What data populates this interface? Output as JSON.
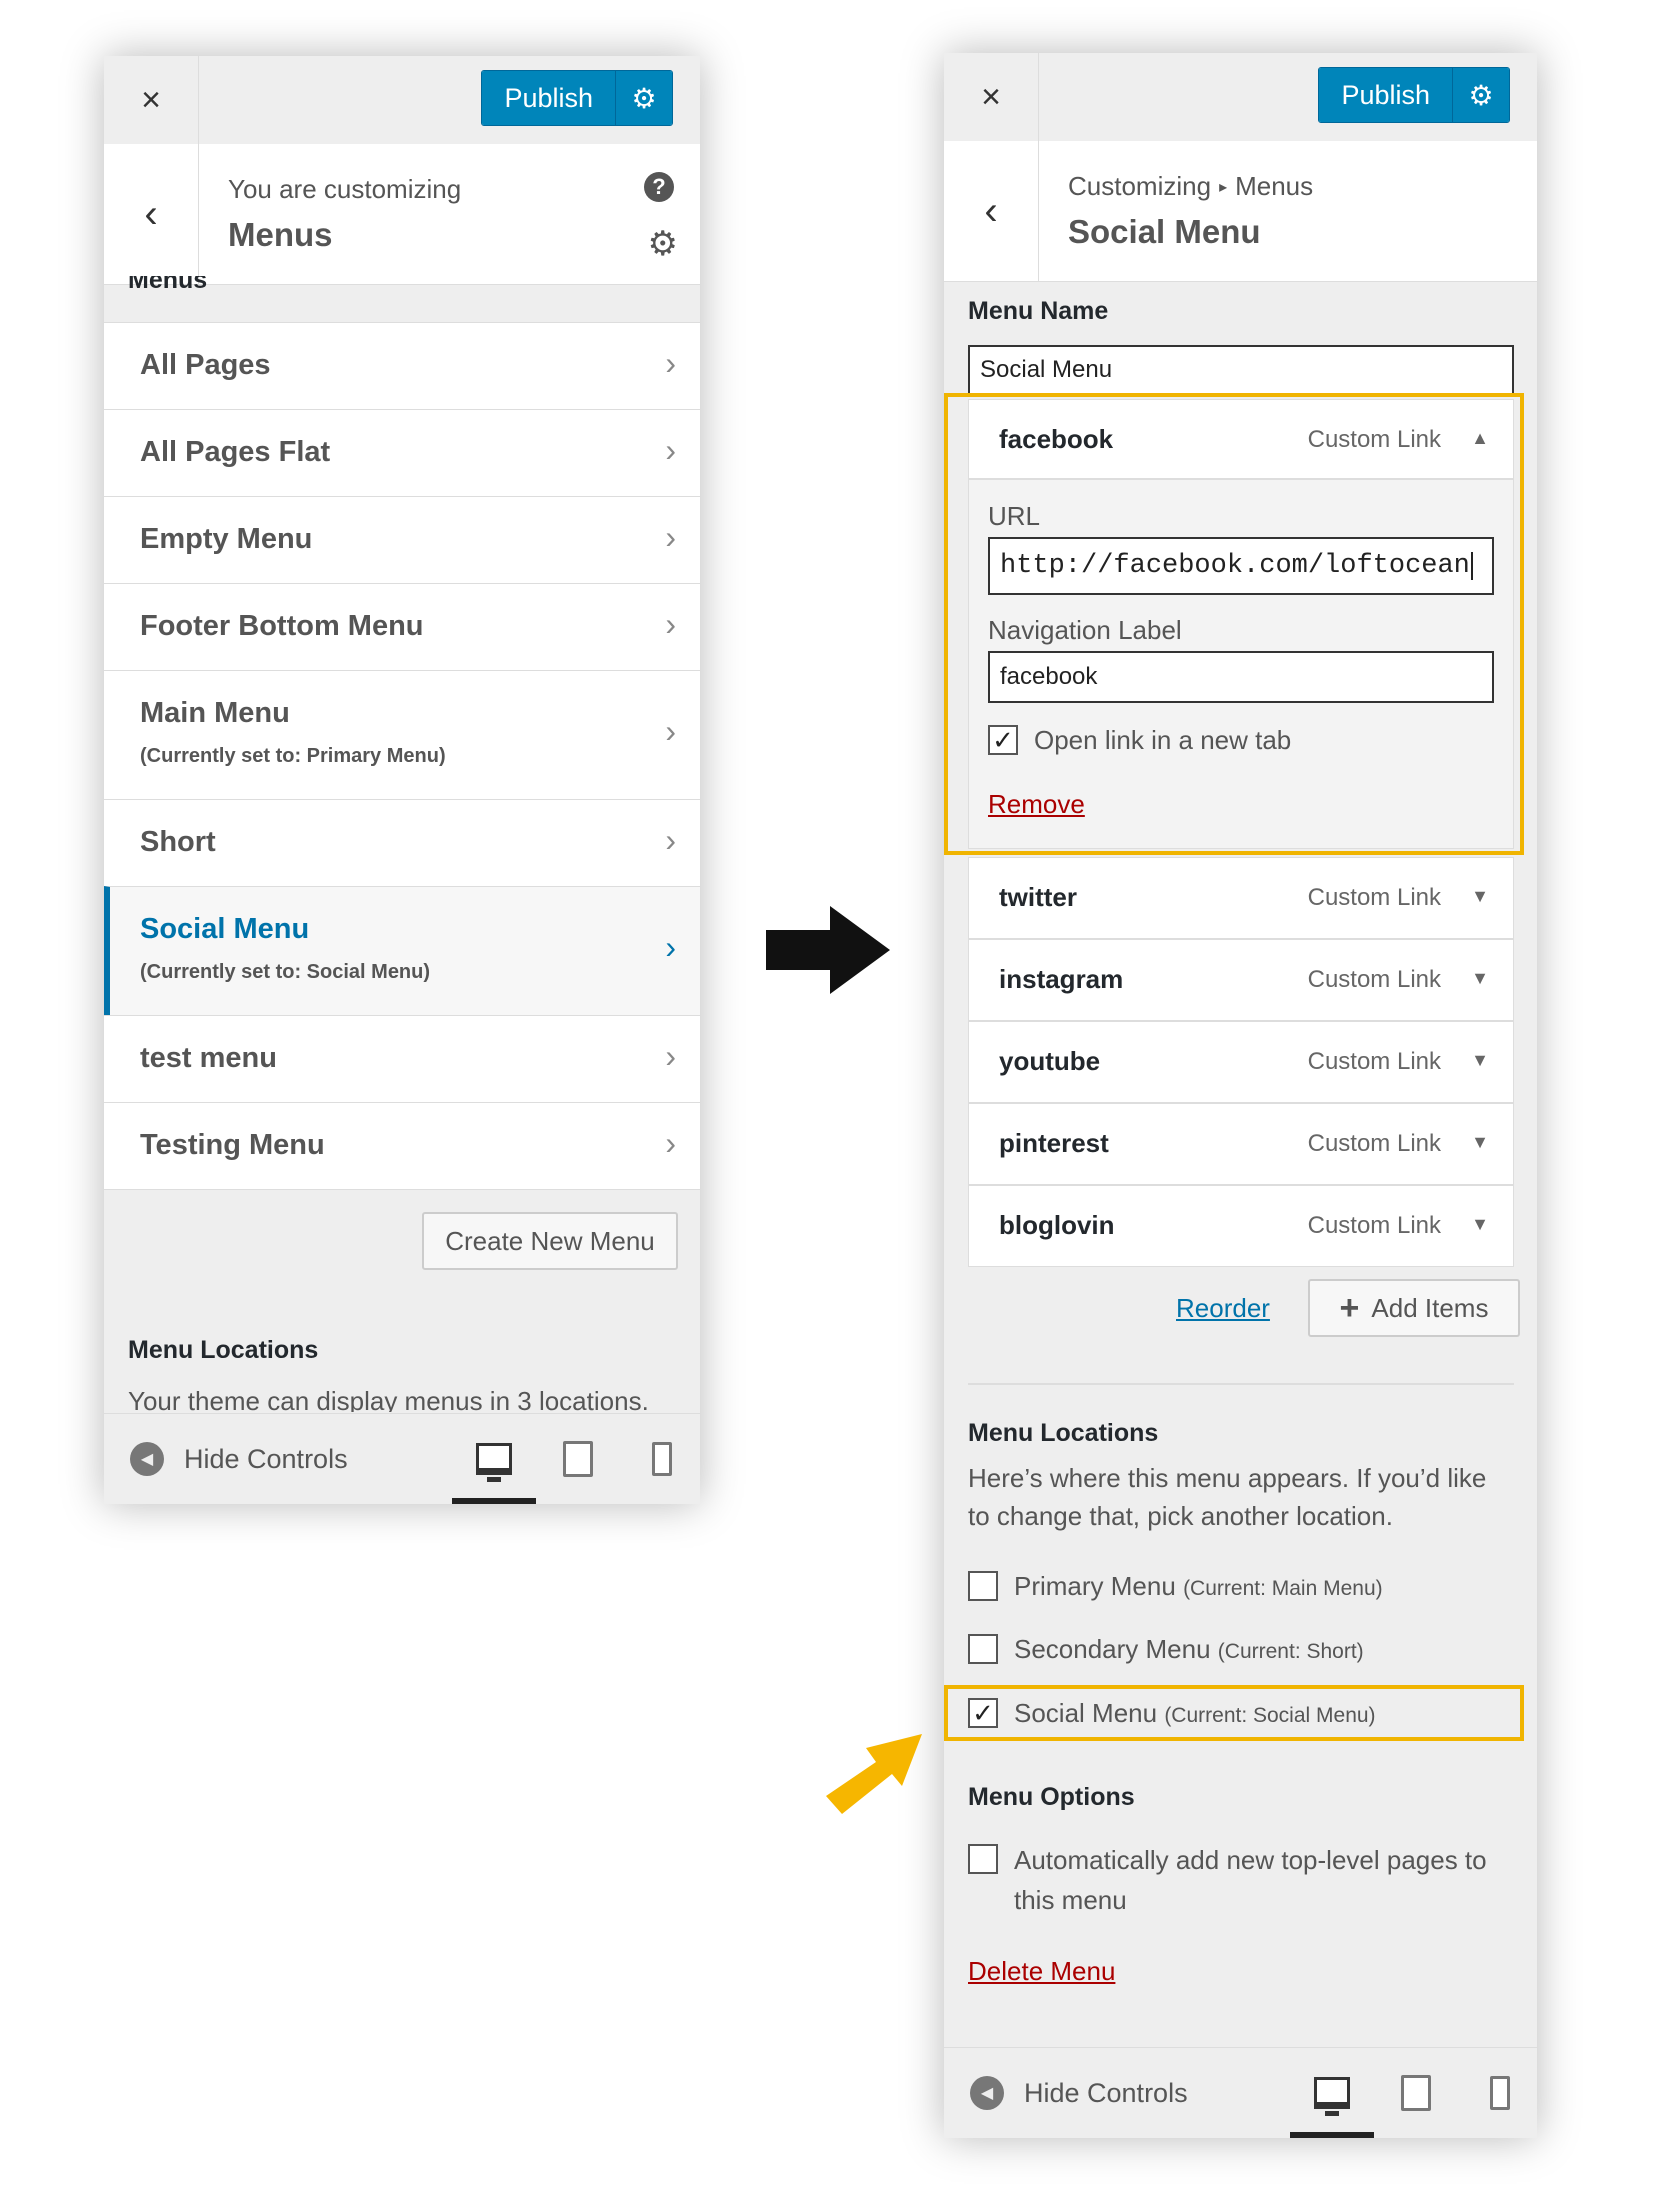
{
  "left_panel": {
    "close_icon": "×",
    "publish_label": "Publish",
    "subtitle": "You are customizing",
    "title": "Menus",
    "help_icon": "?",
    "clipped_heading": "Menus",
    "menus": [
      {
        "label": "All Pages",
        "sub": ""
      },
      {
        "label": "All Pages Flat",
        "sub": ""
      },
      {
        "label": "Empty Menu",
        "sub": ""
      },
      {
        "label": "Footer Bottom Menu",
        "sub": ""
      },
      {
        "label": "Main Menu",
        "sub": "(Currently set to: Primary Menu)"
      },
      {
        "label": "Short",
        "sub": ""
      },
      {
        "label": "Social Menu",
        "sub": "(Currently set to: Social Menu)"
      },
      {
        "label": "test menu",
        "sub": ""
      },
      {
        "label": "Testing Menu",
        "sub": ""
      }
    ],
    "create_button": "Create New Menu",
    "locations_heading": "Menu Locations",
    "locations_desc": "Your theme can display menus in 3 locations.",
    "hide_controls": "Hide Controls"
  },
  "right_panel": {
    "close_icon": "×",
    "publish_label": "Publish",
    "breadcrumb_root": "Customizing",
    "breadcrumb_sep": "▸",
    "breadcrumb_leaf": "Menus",
    "title": "Social Menu",
    "menu_name_label": "Menu Name",
    "menu_name_value": "Social Menu",
    "expanded_item": {
      "title": "facebook",
      "type": "Custom Link",
      "url_label": "URL",
      "url_value": "http://facebook.com/loftocean",
      "nav_label_label": "Navigation Label",
      "nav_label_value": "facebook",
      "new_tab_label": "Open link in a new tab",
      "new_tab_checked": true,
      "remove_label": "Remove"
    },
    "items": [
      {
        "title": "twitter",
        "type": "Custom Link"
      },
      {
        "title": "instagram",
        "type": "Custom Link"
      },
      {
        "title": "youtube",
        "type": "Custom Link"
      },
      {
        "title": "pinterest",
        "type": "Custom Link"
      },
      {
        "title": "bloglovin",
        "type": "Custom Link"
      }
    ],
    "reorder_label": "Reorder",
    "add_items_label": "Add Items",
    "locations_heading": "Menu Locations",
    "locations_desc": "Here’s where this menu appears. If you’d like to change that, pick another location.",
    "locations": [
      {
        "name": "Primary Menu",
        "current": "(Current: Main Menu)",
        "checked": false
      },
      {
        "name": "Secondary Menu",
        "current": "(Current: Short)",
        "checked": false
      },
      {
        "name": "Social Menu",
        "current": "(Current: Social Menu)",
        "checked": true
      }
    ],
    "options_heading": "Menu Options",
    "auto_add_label": "Automatically add new top-level pages to this menu",
    "delete_label": "Delete Menu",
    "hide_controls": "Hide Controls"
  },
  "colors": {
    "accent_blue": "#0085ba",
    "link_blue": "#0073aa",
    "highlight_yellow": "#f0b400",
    "danger_red": "#aa0000"
  }
}
